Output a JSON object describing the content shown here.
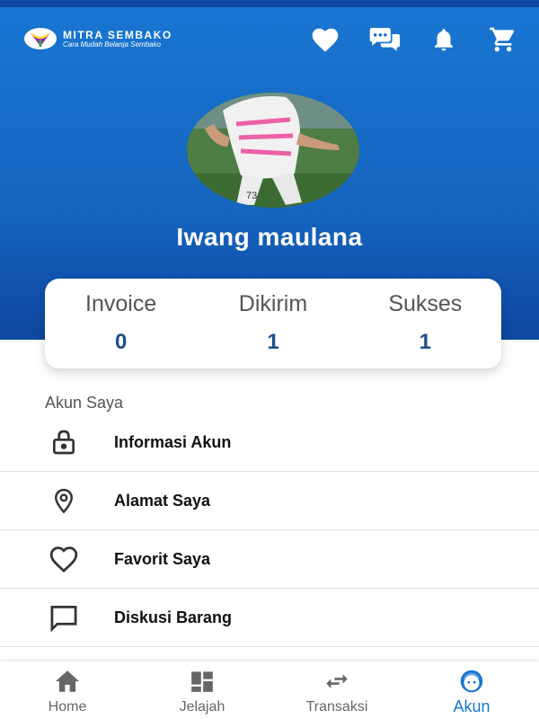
{
  "header": {
    "logo_title": "MITRA SEMBAKO",
    "logo_subtitle": "Cara Mudah Belanja Sembako",
    "icons": [
      "heart-icon",
      "chat-icon",
      "bell-icon",
      "cart-icon"
    ]
  },
  "profile": {
    "name": "Iwang maulana"
  },
  "stats": [
    {
      "label": "Invoice",
      "value": "0"
    },
    {
      "label": "Dikirim",
      "value": "1"
    },
    {
      "label": "Sukses",
      "value": "1"
    }
  ],
  "account": {
    "section_title": "Akun Saya",
    "items": [
      {
        "label": "Informasi Akun",
        "icon": "lock-icon"
      },
      {
        "label": "Alamat Saya",
        "icon": "location-pin-icon"
      },
      {
        "label": "Favorit Saya",
        "icon": "heart-outline-icon"
      },
      {
        "label": "Diskusi Barang",
        "icon": "message-icon"
      }
    ]
  },
  "bottom_nav": [
    {
      "label": "Home",
      "icon": "home-icon",
      "active": false
    },
    {
      "label": "Jelajah",
      "icon": "grid-icon",
      "active": false
    },
    {
      "label": "Transaksi",
      "icon": "swap-icon",
      "active": false
    },
    {
      "label": "Akun",
      "icon": "face-icon",
      "active": true
    }
  ],
  "colors": {
    "primary": "#1565c0",
    "accent_text": "#1d4e89",
    "active_nav": "#1976d2"
  }
}
